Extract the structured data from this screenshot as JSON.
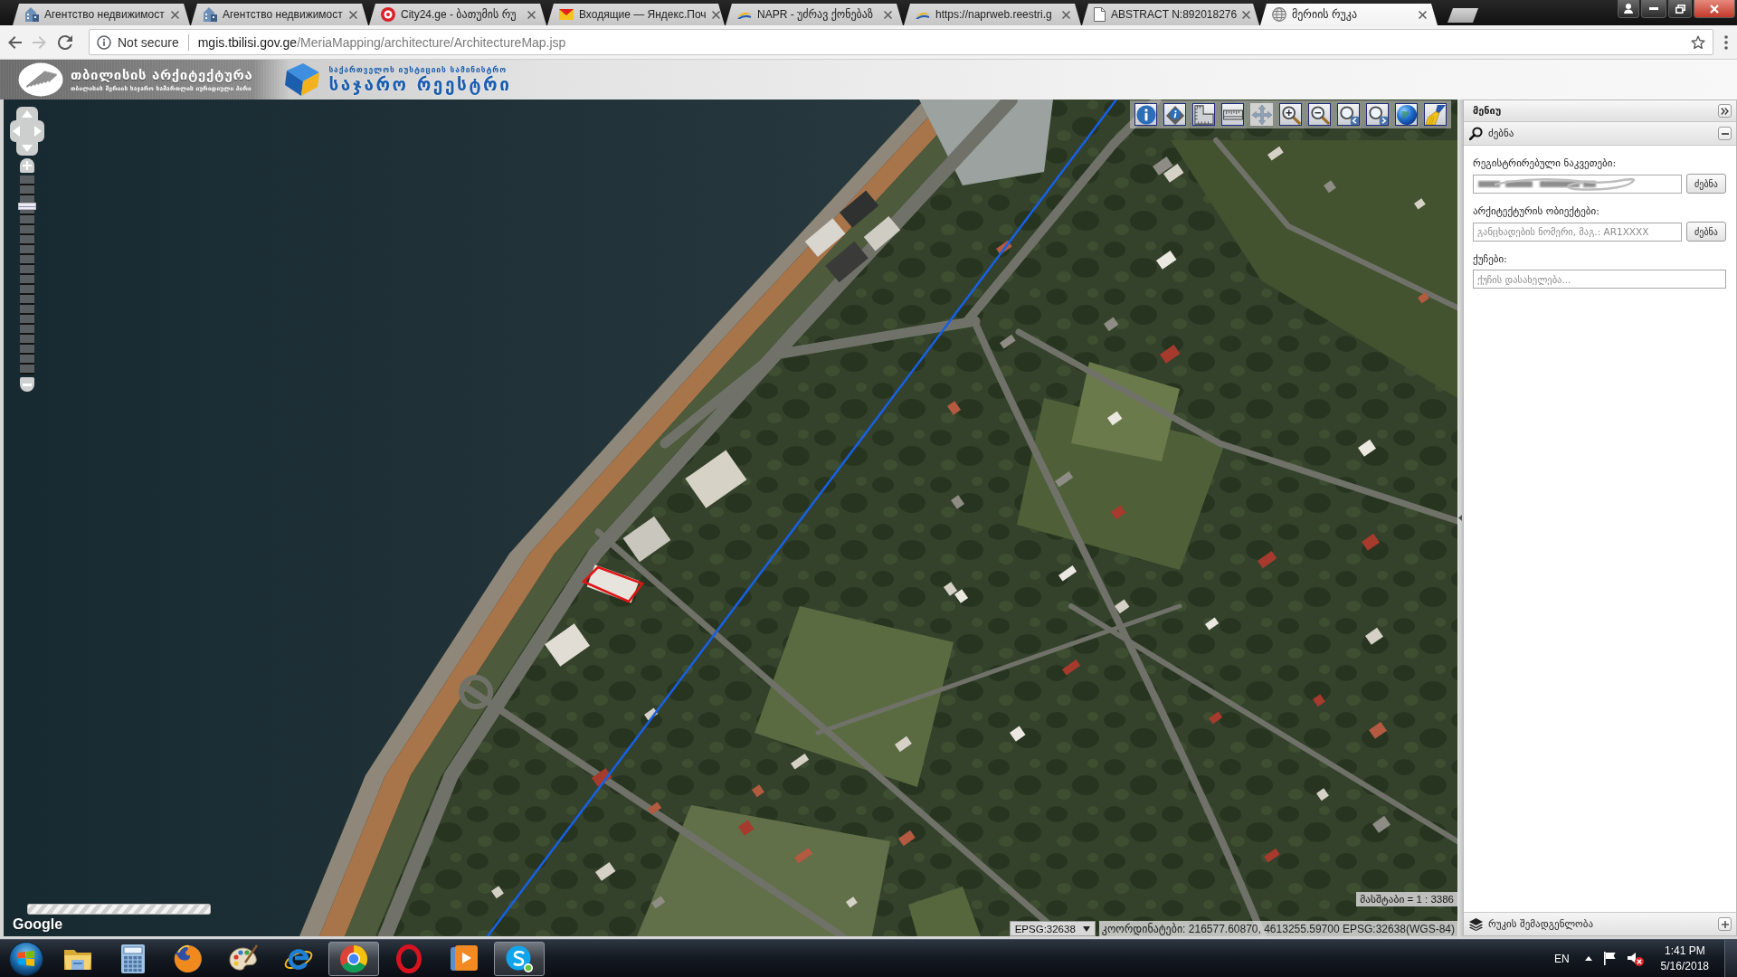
{
  "browser": {
    "tabs": [
      {
        "title": "Агентство недвижимост",
        "kind": "building",
        "selected": false
      },
      {
        "title": "Агентство недвижимост",
        "kind": "building",
        "selected": false
      },
      {
        "title": "City24.ge - ბათუმის რუ",
        "kind": "circle-logo",
        "selected": false
      },
      {
        "title": "Входящие — Яндекс.Поч",
        "kind": "envelope",
        "selected": false
      },
      {
        "title": "NAPR - უძრავ ქონებაზ",
        "kind": "wing-logo",
        "selected": false
      },
      {
        "title": "https://naprweb.reestri.g",
        "kind": "wing-logo",
        "selected": false
      },
      {
        "title": "ABSTRACT N:892018276",
        "kind": "document",
        "selected": false
      },
      {
        "title": "მერიის რუკა",
        "kind": "globe",
        "selected": true
      }
    ],
    "nav_buttons": [
      {
        "kind": "back",
        "disabled": false
      },
      {
        "kind": "forward",
        "disabled": true
      },
      {
        "kind": "reload",
        "disabled": false
      }
    ],
    "address_bar": {
      "security_label": "Not secure",
      "url_host": "mgis.tbilisi.gov.ge",
      "url_path": "/MeriaMapping/architecture/ArchitectureMap.jsp"
    }
  },
  "site_header": {
    "logo_title": "თბილისის არქიტექტურა",
    "logo_subtitle": "თბილისის მერიის საჯარო სამართლის იურიდიული პირი",
    "registry_ministry": "საქართველოს იუსტიციის სამინისტრო",
    "registry_name": "საჯარო რეესტრი"
  },
  "map": {
    "toolbar": [
      {
        "kind": "info",
        "selected": false
      },
      {
        "kind": "info-diamond",
        "selected": false
      },
      {
        "kind": "area-measure",
        "selected": false
      },
      {
        "kind": "ruler",
        "selected": false
      },
      {
        "kind": "pan",
        "selected": true
      },
      {
        "kind": "zoom-in",
        "selected": false
      },
      {
        "kind": "zoom-out",
        "selected": false
      },
      {
        "kind": "zoom-previous",
        "selected": false
      },
      {
        "kind": "zoom-next",
        "selected": false
      },
      {
        "kind": "globe",
        "selected": false
      },
      {
        "kind": "brush",
        "selected": false
      }
    ],
    "zoom_slider": {
      "level": 0.86
    },
    "attribution": "Google",
    "scale": "მასშტაბი = 1 : 3386",
    "projection": "EPSG:32638",
    "coordinates": "კოორდინატები: 216577.60870, 4613255.59700 EPSG:32638(WGS-84)"
  },
  "panel": {
    "title": "მენიუ",
    "search": {
      "title": "ძებნა",
      "expanded": true,
      "fields": [
        {
          "label": "რეგისტრირებული ნაკვეთები:",
          "redacted": true,
          "button": "ძებნა"
        },
        {
          "label": "არქიტექტურის ობიექტები:",
          "redacted": false,
          "placeholder": "განცხადების ნომერი, მაგ.: AR1XXXX",
          "button": "ძებნა"
        },
        {
          "label": "ქუჩები:",
          "redacted": false,
          "placeholder": "ქუჩის დასახელება..."
        }
      ]
    },
    "layers": {
      "title": "რუკის შემადგენლობა",
      "expanded": false
    }
  },
  "taskbar": {
    "apps": [
      {
        "kind": "folder",
        "active": false
      },
      {
        "kind": "calculator",
        "active": false
      },
      {
        "kind": "fox-globe",
        "active": false
      },
      {
        "kind": "palette",
        "active": false
      },
      {
        "kind": "e-logo",
        "active": false
      },
      {
        "kind": "color-wheel",
        "active": true
      },
      {
        "kind": "ring-logo",
        "active": false
      },
      {
        "kind": "play",
        "active": false
      },
      {
        "kind": "chat-logo",
        "active": true
      }
    ],
    "language": "EN",
    "volume_muted": true,
    "time": "1:41 PM",
    "date": "5/16/2018"
  }
}
